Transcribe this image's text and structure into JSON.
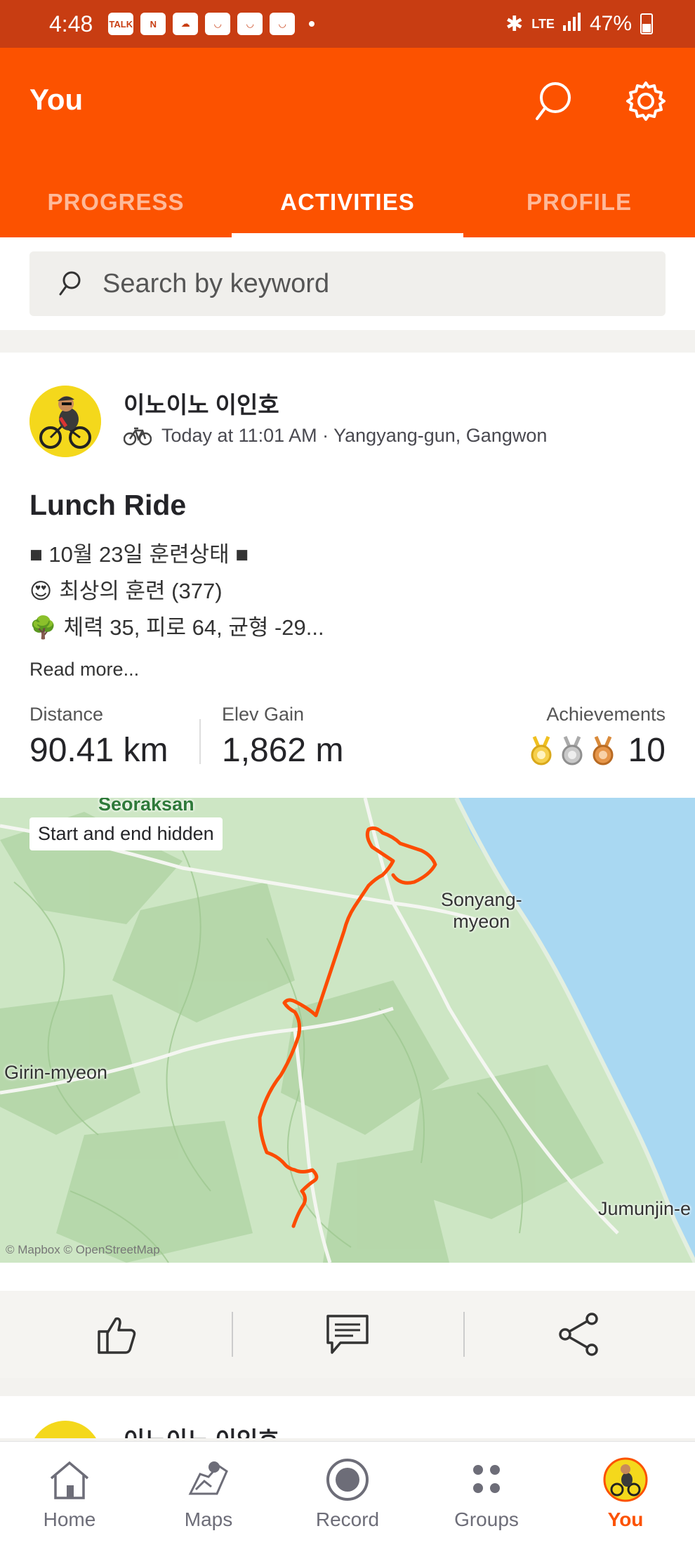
{
  "status_bar": {
    "time": "4:48",
    "notifications": [
      "TALK",
      "N",
      "",
      "",
      "",
      ""
    ],
    "network": "LTE",
    "battery": "47%"
  },
  "header": {
    "title": "You",
    "tabs": [
      {
        "label": "PROGRESS",
        "active": false
      },
      {
        "label": "ACTIVITIES",
        "active": true
      },
      {
        "label": "PROFILE",
        "active": false
      }
    ]
  },
  "search": {
    "placeholder": "Search by keyword"
  },
  "activity": {
    "athlete": "이노이노 이인호",
    "meta": "Today at 11:01 AM · Yangyang-gun, Gangwon",
    "title": "Lunch Ride",
    "description": [
      "■ 10월 23일 훈련상태 ■",
      "최상의 훈련 (377)",
      "체력 35, 피로 64, 균형 -29..."
    ],
    "description_emoji": [
      "",
      "😍",
      "🌳"
    ],
    "read_more": "Read more...",
    "stats": {
      "distance_label": "Distance",
      "distance_value": "90.41 km",
      "elev_label": "Elev Gain",
      "elev_value": "1,862 m",
      "achievements_label": "Achievements",
      "achievements_count": "10"
    },
    "map": {
      "badge": "Start and end hidden",
      "labels": [
        "Seoraksan",
        "Sonyang-\nmyeon",
        "Girin-myeon",
        "Jumunjin-e"
      ],
      "attribution": "© Mapbox © OpenStreetMap"
    }
  },
  "next_activity": {
    "athlete": "이노이노 이인호"
  },
  "bottom_nav": [
    {
      "label": "Home",
      "icon": "home-icon",
      "active": false
    },
    {
      "label": "Maps",
      "icon": "map-icon",
      "active": false
    },
    {
      "label": "Record",
      "icon": "record-icon",
      "active": false
    },
    {
      "label": "Groups",
      "icon": "groups-icon",
      "active": false
    },
    {
      "label": "You",
      "icon": "avatar-icon",
      "active": true
    }
  ],
  "colors": {
    "brand": "#fc5200",
    "status_bar": "#c83d12",
    "route": "#fc4c02"
  }
}
